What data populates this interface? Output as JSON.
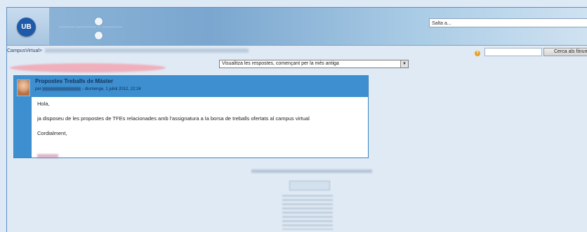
{
  "header": {
    "logo_text": "UB",
    "jump_placeholder": "Salta a..."
  },
  "breadcrumb": {
    "root": "CampusVirtual",
    "separator": ">"
  },
  "search": {
    "button_label": "Cerca als fòrums"
  },
  "discussion": {
    "sort_selected": "Visualitza les respostes, començant per la més antiga"
  },
  "post": {
    "title": "Propostes Treballs de Màster",
    "meta_prefix": "per",
    "meta_date": "- diumenge, 1 juliol 2012, 22:24",
    "body": {
      "greeting": "Hola,",
      "paragraph": "ja disposeu de les propostes de TFEs relacionades amb l'assignatura a la borsa de treballs ofertats al campus virtual",
      "closing": "Cordialment,"
    }
  },
  "icons": {
    "help": "help-icon",
    "dropdown": "chevron-down-icon"
  },
  "colors": {
    "post_header": "#3d8fcf",
    "page_bg": "#dfeaf5",
    "title_text": "#15325a"
  }
}
